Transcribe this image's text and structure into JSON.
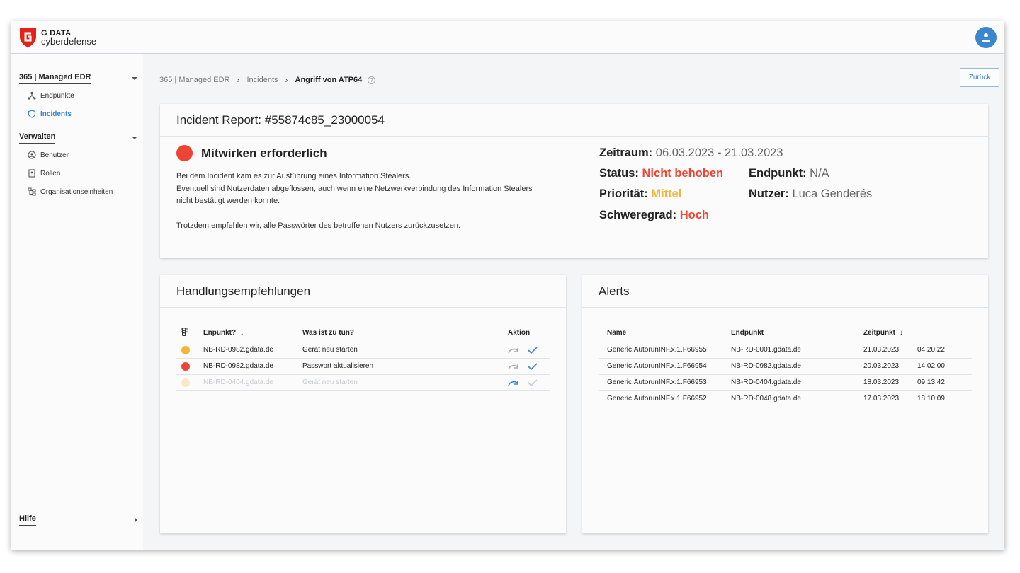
{
  "brand": {
    "line1": "G DATA",
    "line2": "cyberdefense",
    "shield_color": "#e2231a"
  },
  "sidebar": {
    "groups": [
      {
        "label": "365 | Managed EDR",
        "items": [
          {
            "label": "Endpunkte",
            "icon": "network-icon"
          },
          {
            "label": "Incidents",
            "icon": "shield-icon",
            "active": true
          }
        ]
      },
      {
        "label": "Verwalten",
        "items": [
          {
            "label": "Benutzer",
            "icon": "user-circle-icon"
          },
          {
            "label": "Rollen",
            "icon": "badge-icon"
          },
          {
            "label": "Organisationseinheiten",
            "icon": "org-tree-icon"
          }
        ]
      }
    ],
    "help": "Hilfe"
  },
  "breadcrumb": {
    "items": [
      "365 | Managed EDR",
      "Incidents"
    ],
    "current": "Angriff von ATP64",
    "help": "?"
  },
  "back_label": "Zurück",
  "report": {
    "title": "Incident Report: #55874c85_23000054",
    "status_label": "Mitwirken erforderlich",
    "status_color": "#ee4433",
    "description": [
      "Bei dem Incident kam es zur Ausführung eines Information Stealers.",
      "Eventuell sind Nutzerdaten abgeflossen, auch wenn eine Netzwerkverbindung des Information Stealers",
      "nicht bestätigt werden konnte.",
      "Trotzdem empfehlen wir, alle Passwörter des betroffenen Nutzers zurückzusetzen."
    ],
    "zeitraum": {
      "label": "Zeitraum:",
      "value": "06.03.2023 - 21.03.2023"
    },
    "status": {
      "label": "Status:",
      "value": "Nicht behoben",
      "color": "#ee4433"
    },
    "prioritaet": {
      "label": "Priorität:",
      "value": "Mittel",
      "color": "#f5b535"
    },
    "schweregrad": {
      "label": "Schweregrad:",
      "value": "Hoch",
      "color": "#ee4433"
    },
    "endpunkt": {
      "label": "Endpunkt:",
      "value": "N/A"
    },
    "nutzer": {
      "label": "Nutzer:",
      "value": "Luca Genderés"
    }
  },
  "recommendations": {
    "title": "Handlungsempfehlungen",
    "columns": {
      "icon": "traffic-light-icon",
      "endpoint": "Enpunkt?",
      "todo": "Was ist zu tun?",
      "action": "Aktion"
    },
    "rows": [
      {
        "dot": "#f5b535",
        "endpoint": "NB-RD-0982.gdata.de",
        "todo": "Gerät neu starten",
        "faded": false
      },
      {
        "dot": "#ee4433",
        "endpoint": "NB-RD-0982.gdata.de",
        "todo": "Passwort aktualisieren",
        "faded": false
      },
      {
        "dot": "#fbe9c6",
        "endpoint": "NB-RD-0404.gdata.de",
        "todo": "Gerät neu starten",
        "faded": true
      }
    ]
  },
  "alerts": {
    "title": "Alerts",
    "columns": {
      "name": "Name",
      "endpoint": "Endpunkt",
      "time": "Zeitpunkt"
    },
    "rows": [
      {
        "name": "Generic.AutorunINF.x.1.F66955",
        "endpoint": "NB-RD-0001.gdata.de",
        "date": "21.03.2023",
        "time": "04:20:22"
      },
      {
        "name": "Generic.AutorunINF.x.1.F66954",
        "endpoint": "NB-RD-0982.gdata.de",
        "date": "20.03.2023",
        "time": "14:02:00"
      },
      {
        "name": "Generic.AutorunINF.x.1.F66953",
        "endpoint": "NB-RD-0404.gdata.de",
        "date": "18.03.2023",
        "time": "09:13:42"
      },
      {
        "name": "Generic.AutorunINF.x.1.F66952",
        "endpoint": "NB-RD-0048.gdata.de",
        "date": "17.03.2023",
        "time": "18:10:09"
      }
    ]
  },
  "accent": "#3a86d0"
}
